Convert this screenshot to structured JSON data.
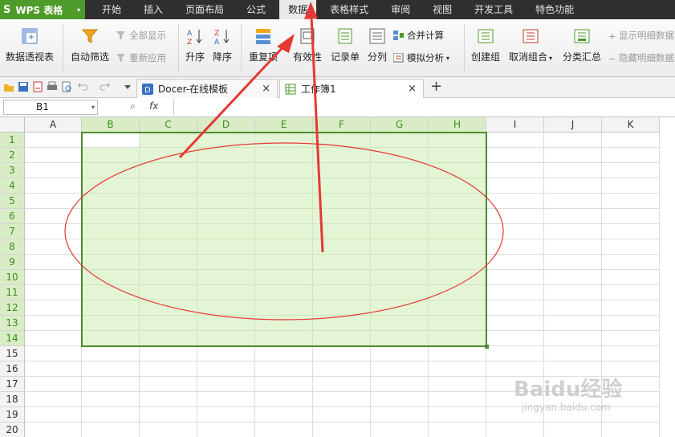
{
  "app": {
    "logo": "S",
    "name": "WPS 表格",
    "dropdown": "▾"
  },
  "menu": [
    {
      "label": "开始",
      "active": false
    },
    {
      "label": "插入",
      "active": false
    },
    {
      "label": "页面布局",
      "active": false
    },
    {
      "label": "公式",
      "active": false
    },
    {
      "label": "数据",
      "active": true
    },
    {
      "label": "表格样式",
      "active": false
    },
    {
      "label": "审阅",
      "active": false
    },
    {
      "label": "视图",
      "active": false
    },
    {
      "label": "开发工具",
      "active": false
    },
    {
      "label": "特色功能",
      "active": false
    }
  ],
  "ribbon": {
    "pivot": "数据透视表",
    "autofilter": "自动筛选",
    "show_all": "全部显示",
    "reapply": "重新应用",
    "sort_asc": "升序",
    "sort_desc": "降序",
    "duplicates": "重复项",
    "validity": "有效性",
    "record_form": "记录单",
    "split": "分列",
    "consolidate": "合并计算",
    "what_if": "模拟分析",
    "group": "创建组",
    "ungroup": "取消组合",
    "subtotal": "分类汇总",
    "show_detail": "显示明细数据",
    "hide_detail": "隐藏明细数据"
  },
  "tabs": {
    "docer": "Docer-在线模板",
    "workbook": "工作簿1",
    "close": "×",
    "new": "+"
  },
  "formula_bar": {
    "name_box": "B1",
    "fx": "fx",
    "value": ""
  },
  "grid": {
    "columns": [
      "A",
      "B",
      "C",
      "D",
      "E",
      "F",
      "G",
      "H",
      "I",
      "J",
      "K"
    ],
    "rows": [
      "1",
      "2",
      "3",
      "4",
      "5",
      "6",
      "7",
      "8",
      "9",
      "10",
      "11",
      "12",
      "13",
      "14",
      "15",
      "16",
      "17",
      "18",
      "19",
      "20"
    ],
    "selection": {
      "from": "B1",
      "to": "H14"
    }
  },
  "watermark": {
    "brand": "Baidu经验",
    "url": "jingyan.baidu.com"
  },
  "colors": {
    "accent": "#4e9a2a",
    "selection_fill": "#e4f5d6",
    "annotation": "#e53935"
  }
}
